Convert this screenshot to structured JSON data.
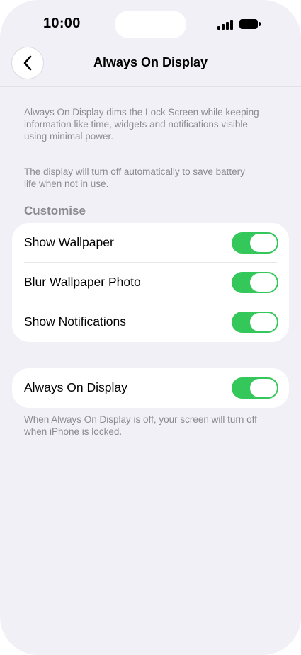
{
  "status_bar": {
    "time": "10:00"
  },
  "nav": {
    "title": "Always On Display",
    "back_icon": "chevron-left-icon"
  },
  "intro": {
    "line1": "Always On Display dims the Lock Screen while keeping",
    "line2": "information like time, widgets and notifications visible",
    "line3": "using minimal power."
  },
  "battery_note": {
    "line1": "The display will turn off automatically to save battery",
    "line2": "life when not in use."
  },
  "customise": {
    "header": "Customise",
    "rows": [
      {
        "label": "Show Wallpaper",
        "on": true
      },
      {
        "label": "Blur Wallpaper Photo",
        "on": true
      },
      {
        "label": "Show Notifications",
        "on": true
      }
    ]
  },
  "aod": {
    "label": "Always On Display",
    "on": true,
    "footer_line1": "When Always On Display is off, your screen will turn off",
    "footer_line2": "when iPhone is locked."
  },
  "colors": {
    "background": "#f1f0f6",
    "toggle_on": "#34c759",
    "secondary_text": "#8a8a8f"
  }
}
